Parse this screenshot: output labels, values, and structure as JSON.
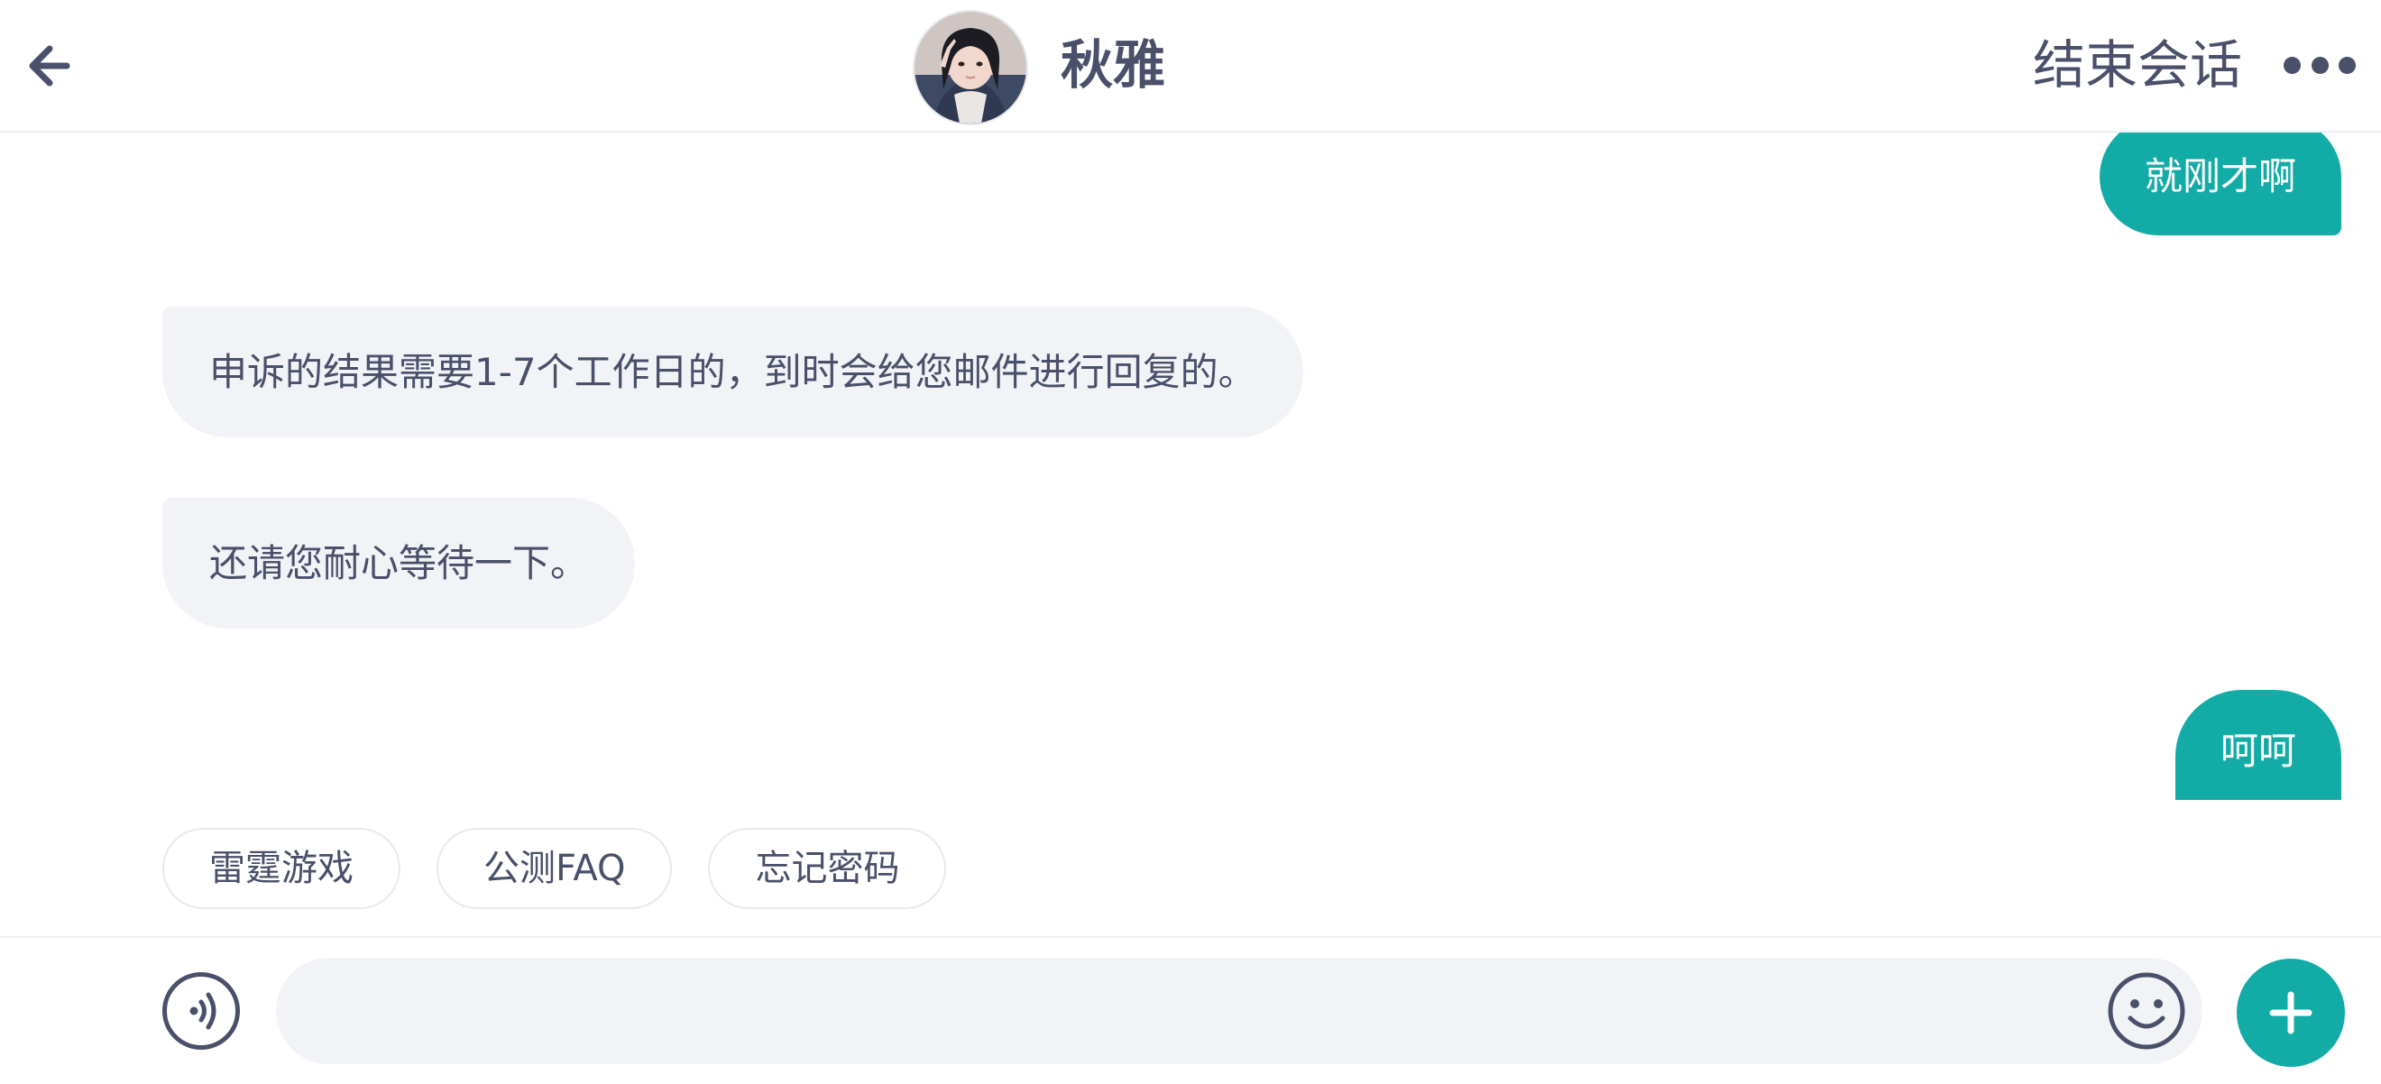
{
  "header": {
    "contact_name": "秋雅",
    "end_session_label": "结束会话",
    "icons": {
      "back": "arrow-left-icon",
      "more": "more-dots-icon",
      "avatar": "avatar-photo"
    }
  },
  "messages": [
    {
      "from": "me",
      "text": "就刚才啊"
    },
    {
      "from": "them",
      "text": "申诉的结果需要1-7个工作日的，到时会给您邮件进行回复的。"
    },
    {
      "from": "them",
      "text": "还请您耐心等待一下。"
    },
    {
      "from": "me",
      "text": "呵呵"
    }
  ],
  "quick_replies": [
    "雷霆游戏",
    "公测FAQ",
    "忘记密码"
  ],
  "input": {
    "value": "",
    "placeholder": "",
    "icons": {
      "voice": "voice-icon",
      "emoji": "emoji-icon",
      "plus": "plus-icon"
    }
  },
  "colors": {
    "accent": "#13aba6",
    "bubble_other": "#f1f3f6",
    "text": "#4a4f6a"
  }
}
